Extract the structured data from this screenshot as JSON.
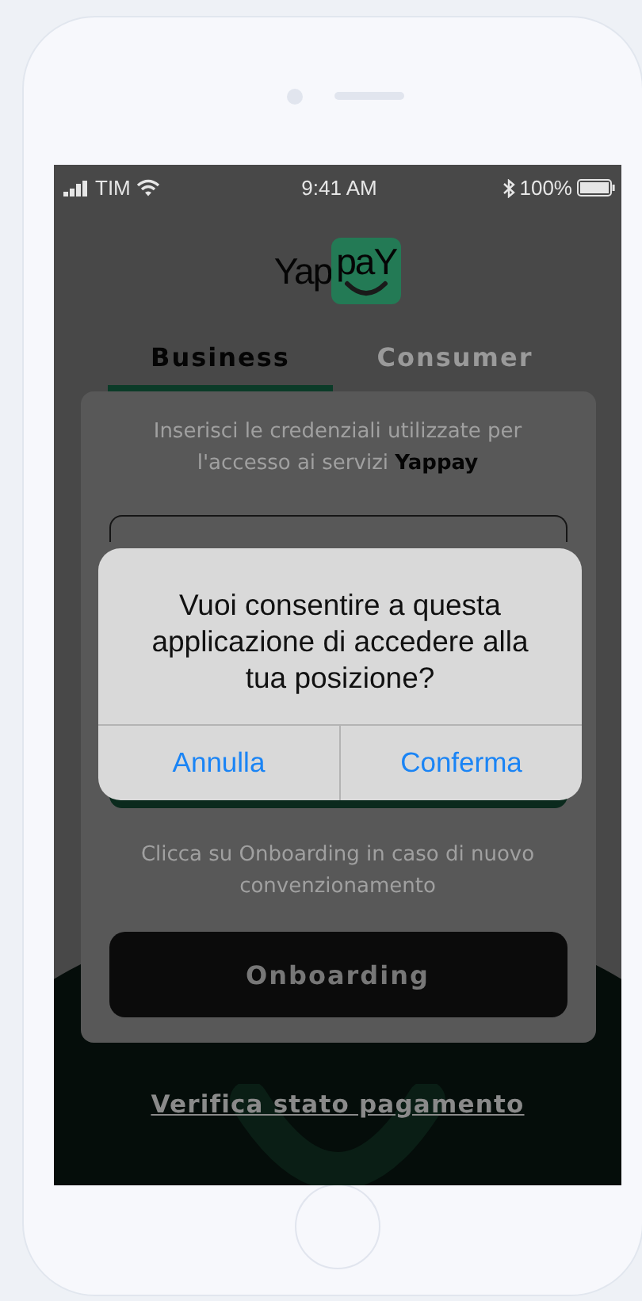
{
  "status_bar": {
    "carrier": "TIM",
    "time": "9:41 AM",
    "battery": "100%"
  },
  "logo": {
    "left": "Yap",
    "right": "paY"
  },
  "tabs": [
    {
      "label": "Business",
      "selected": true
    },
    {
      "label": "Consumer",
      "selected": false
    }
  ],
  "intro": "Inserisci le credenziali utilizzate per l'accesso ai servizi **Yappay**",
  "onboarding_hint": "Clicca su Onboarding in caso di nuovo convenzionamento",
  "onboarding_button": "Onboarding",
  "payment_link": "Verifica stato pagamento",
  "alert": {
    "message": "Vuoi consentire a questa applicazione di accedere alla tua posizione?",
    "buttons": [
      "Annulla",
      "Conferma"
    ]
  }
}
